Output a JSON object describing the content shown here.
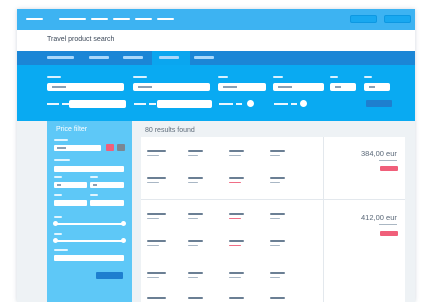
{
  "window": {
    "title": "Travel product search",
    "accent": "#09aaf2",
    "nav_color": "#1b86d6",
    "filter_color": "#5ec8f7",
    "book_color": "#f05f7a"
  },
  "filter": {
    "title": "Price filter"
  },
  "results": {
    "summary": "80 results found",
    "items": [
      {
        "price": "384,00 eur"
      },
      {
        "price": "412,00 eur"
      }
    ]
  }
}
